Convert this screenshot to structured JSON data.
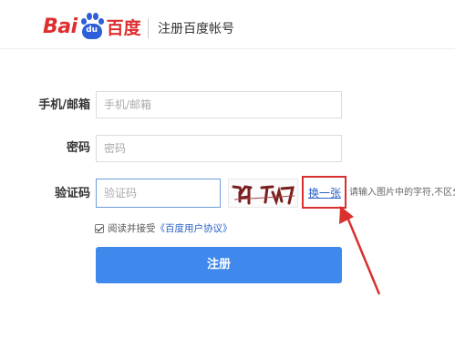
{
  "header": {
    "logo_bai": "Bai",
    "logo_du": "du",
    "logo_cn": "百度",
    "title": "注册百度帐号"
  },
  "form": {
    "phone_label": "手机/邮箱",
    "phone_placeholder": "手机/邮箱",
    "password_label": "密码",
    "password_placeholder": "密码",
    "captcha_label": "验证码",
    "captcha_placeholder": "验证码",
    "captcha_image_text": "Y1 Tr7",
    "refresh_link": "换一张",
    "captcha_hint": "请输入图片中的字符,不区分",
    "agree_text": "阅读并接受",
    "agree_link": "《百度用户协议》",
    "agree_checked": true,
    "submit_label": "注册"
  },
  "colors": {
    "brand_red": "#de2e2e",
    "brand_blue": "#2f5fd8",
    "submit_blue": "#3f89ec",
    "annotation_red": "#d9302f"
  }
}
